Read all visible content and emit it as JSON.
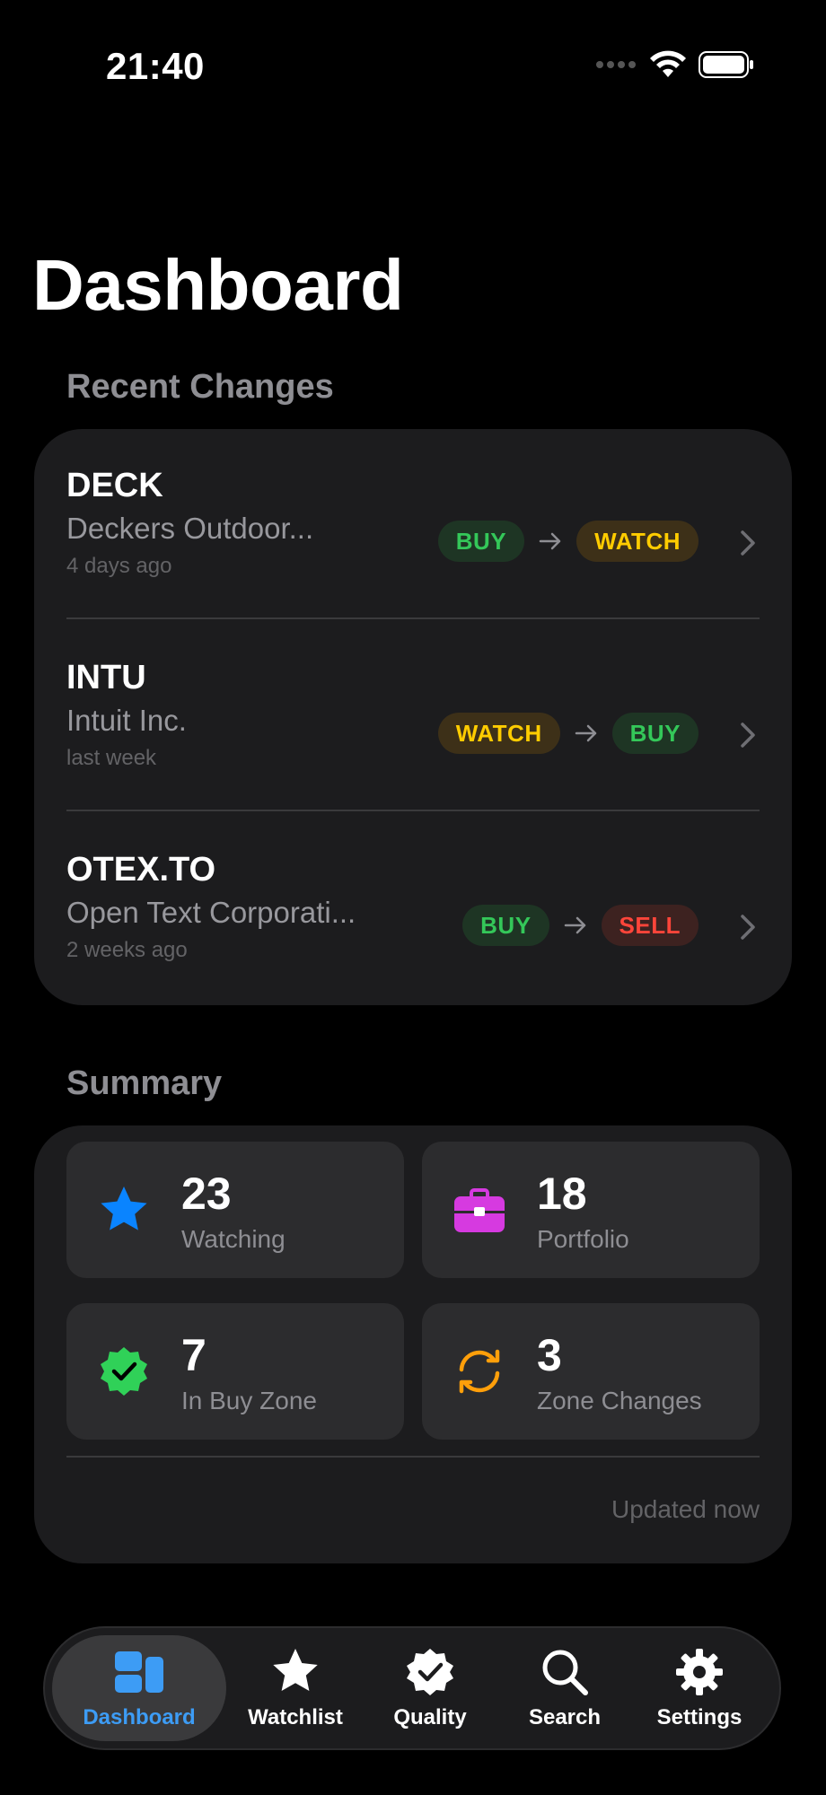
{
  "status_bar": {
    "time": "21:40"
  },
  "page": {
    "title": "Dashboard"
  },
  "recent_changes": {
    "header": "Recent Changes",
    "items": [
      {
        "ticker": "DECK",
        "company": "Deckers Outdoor...",
        "time": "4 days ago",
        "from": "BUY",
        "to": "WATCH"
      },
      {
        "ticker": "INTU",
        "company": "Intuit Inc.",
        "time": "last week",
        "from": "WATCH",
        "to": "BUY"
      },
      {
        "ticker": "OTEX.TO",
        "company": "Open Text Corporati...",
        "time": "2 weeks ago",
        "from": "BUY",
        "to": "SELL"
      }
    ]
  },
  "summary": {
    "header": "Summary",
    "tiles": [
      {
        "value": "23",
        "label": "Watching",
        "icon": "star-icon",
        "color": "#0a84ff"
      },
      {
        "value": "18",
        "label": "Portfolio",
        "icon": "briefcase-icon",
        "color": "#d63ae0"
      },
      {
        "value": "7",
        "label": "In Buy Zone",
        "icon": "checkmark-seal-icon",
        "color": "#30d158"
      },
      {
        "value": "3",
        "label": "Zone Changes",
        "icon": "refresh-icon",
        "color": "#ff9f0a"
      }
    ],
    "updated": "Updated now"
  },
  "tabbar": {
    "tabs": [
      {
        "label": "Dashboard",
        "icon": "dashboard-icon",
        "active": true
      },
      {
        "label": "Watchlist",
        "icon": "star-icon",
        "active": false
      },
      {
        "label": "Quality",
        "icon": "checkmark-seal-icon",
        "active": false
      },
      {
        "label": "Search",
        "icon": "search-icon",
        "active": false
      },
      {
        "label": "Settings",
        "icon": "gear-icon",
        "active": false
      }
    ]
  },
  "colors": {
    "accent": "#3d9cf5",
    "buy": "#34c759",
    "watch": "#ffcc00",
    "sell": "#ff453a"
  }
}
